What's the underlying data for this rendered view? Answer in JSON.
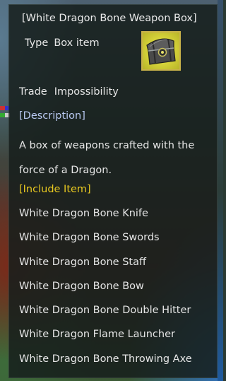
{
  "tooltip": {
    "title": "[White Dragon Bone Weapon Box]",
    "type_label": "Type",
    "type_value": "Box item",
    "icon": "treasure-chest-icon",
    "trade_label": "Trade",
    "trade_value": "Impossibility",
    "description_header": "[Description]",
    "description": "A box of weapons crafted with the force of a Dragon.",
    "include_header": "[Include Item]",
    "include_items": [
      "White Dragon Bone Knife",
      "White Dragon Bone Swords",
      "White Dragon Bone Staff",
      "White Dragon Bone Bow",
      "White Dragon Bone Double Hitter",
      "White Dragon Flame Launcher",
      "White Dragon Bone Throwing Axe"
    ]
  },
  "colors": {
    "text": "#e6e6e6",
    "description_header": "#b8c8f0",
    "include_header": "#e8c820",
    "icon_border": "#c9b24a",
    "panel_background": "#161e1c"
  }
}
